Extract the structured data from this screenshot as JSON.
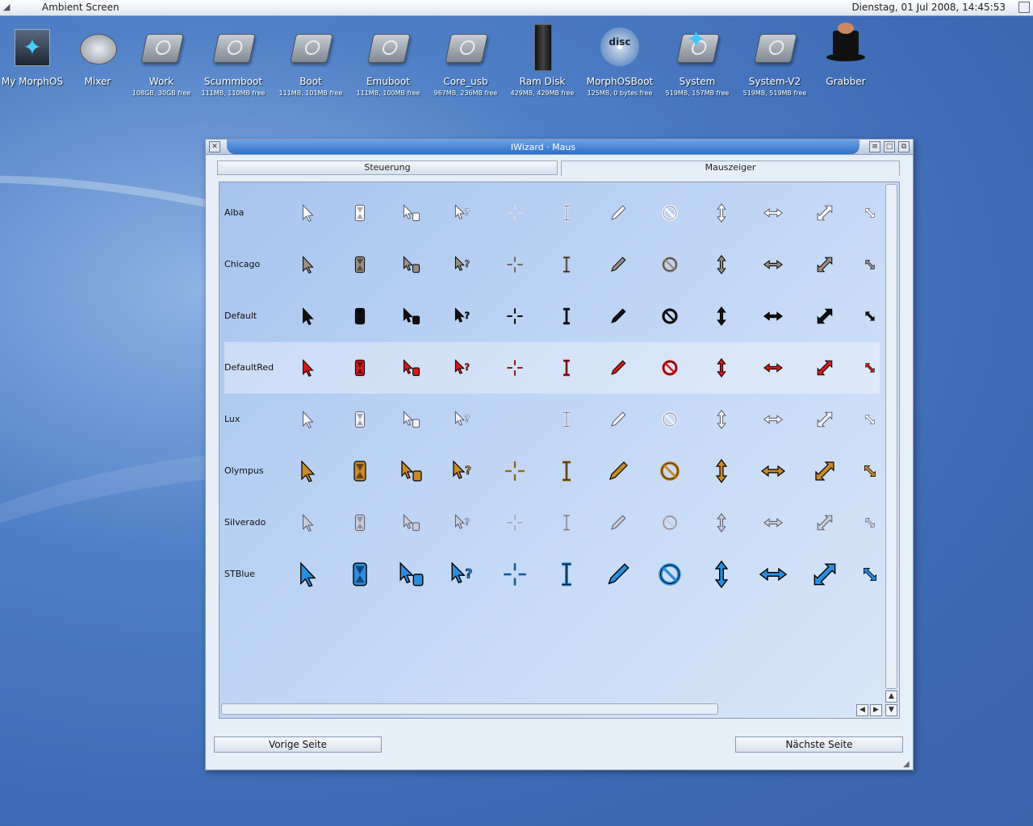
{
  "topbar": {
    "title": "Ambient Screen",
    "clock": "Dienstag, 01 Jul 2008, 14:45:53"
  },
  "desktop_icons": [
    {
      "label": "My MorphOS",
      "sub": "",
      "icon": "butterfly-icon"
    },
    {
      "label": "Mixer",
      "sub": "",
      "icon": "mixer-icon"
    },
    {
      "label": "Work",
      "sub": "108GB, 30GB free",
      "icon": "harddisk-icon"
    },
    {
      "label": "Scummboot",
      "sub": "111MB, 110MB free",
      "icon": "harddisk-icon"
    },
    {
      "label": "Boot",
      "sub": "111MB, 101MB free",
      "icon": "harddisk-icon"
    },
    {
      "label": "Emuboot",
      "sub": "111MB, 100MB free",
      "icon": "harddisk-icon"
    },
    {
      "label": "Core_usb",
      "sub": "967MB, 236MB free",
      "icon": "harddisk-icon"
    },
    {
      "label": "Ram Disk",
      "sub": "429MB, 429MB free",
      "icon": "ramdisk-icon"
    },
    {
      "label": "MorphOSBoot",
      "sub": "125MB, 0 bytes free",
      "icon": "disc-icon"
    },
    {
      "label": "System",
      "sub": "519MB, 157MB free",
      "icon": "butterfly-drive-icon"
    },
    {
      "label": "System-V2",
      "sub": "519MB, 519MB free",
      "icon": "harddisk-icon"
    },
    {
      "label": "Grabber",
      "sub": "",
      "icon": "grabber-hat-icon"
    }
  ],
  "window": {
    "title": "IWizard · Maus",
    "tabs": [
      "Steuerung",
      "Mauszeiger"
    ],
    "active_tab": 1,
    "themes": [
      {
        "name": "Alba",
        "color": "#ffffff",
        "style": "outline"
      },
      {
        "name": "Chicago",
        "color": "#9a8f86",
        "style": "solid"
      },
      {
        "name": "Default",
        "color": "#111111",
        "style": "solid"
      },
      {
        "name": "DefaultRed",
        "color": "#d21a1a",
        "style": "solid"
      },
      {
        "name": "Lux",
        "color": "#f0f4fa",
        "style": "outline"
      },
      {
        "name": "Olympus",
        "color": "#c98a2a",
        "style": "solid"
      },
      {
        "name": "Silverado",
        "color": "#c8ccd8",
        "style": "outline"
      },
      {
        "name": "STBlue",
        "color": "#2b8de0",
        "style": "solid"
      }
    ],
    "pointer_types": [
      "arrow",
      "busy",
      "work",
      "help",
      "crosshair",
      "text",
      "pen",
      "forbidden",
      "resize-ns",
      "resize-we",
      "resize-nesw",
      "resize-nwse"
    ],
    "selected_theme": "DefaultRed",
    "prev_button": "Vorige Seite",
    "next_button": "Nächste Seite"
  }
}
